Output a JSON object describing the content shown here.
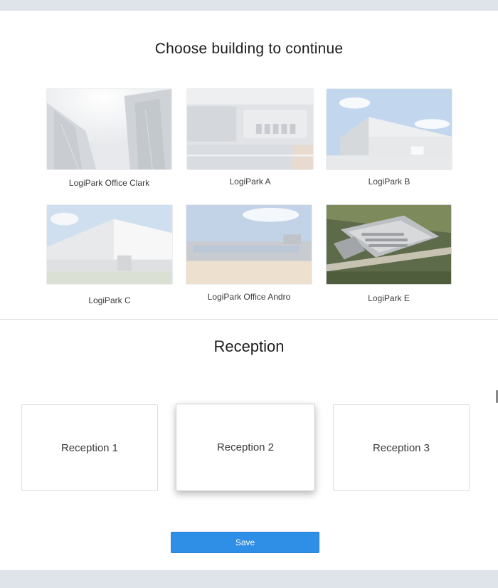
{
  "page": {
    "title": "Choose building to continue"
  },
  "buildings": [
    {
      "label": "LogiPark Office Clark",
      "image": "office-towers-photo",
      "selected": false
    },
    {
      "label": "LogiPark A",
      "image": "aerial-rooftop-photo",
      "selected": false
    },
    {
      "label": "LogiPark B",
      "image": "warehouse-hangar-photo",
      "selected": false
    },
    {
      "label": "LogiPark C",
      "image": "warehouse-building-photo",
      "selected": false
    },
    {
      "label": "LogiPark Office Andro",
      "image": "industrial-site-photo",
      "selected": false
    },
    {
      "label": "LogiPark E",
      "image": "aerial-logistics-park-photo",
      "selected": true
    }
  ],
  "reception": {
    "title": "Reception",
    "options": [
      {
        "label": "Reception 1",
        "selected": false
      },
      {
        "label": "Reception 2",
        "selected": true
      },
      {
        "label": "Reception 3",
        "selected": false
      }
    ]
  },
  "actions": {
    "save_label": "Save",
    "accent_color": "#2f8ee5"
  }
}
